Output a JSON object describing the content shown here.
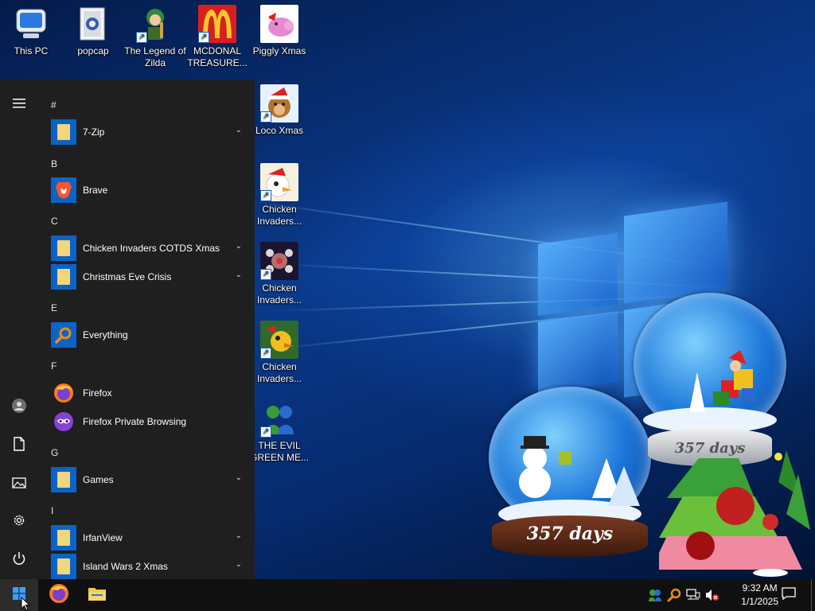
{
  "desktop": {
    "icons": [
      {
        "label": "This PC",
        "icon": "computer-icon"
      },
      {
        "label": "popcap",
        "icon": "folder-icon"
      },
      {
        "label": "The Legend of Zilda",
        "icon": "game-icon"
      },
      {
        "label": "MCDONAL TREASURE...",
        "icon": "game-icon"
      },
      {
        "label": "Piggly Xmas",
        "icon": "game-icon"
      },
      {
        "label": "Loco Xmas",
        "icon": "game-icon"
      },
      {
        "label": "Chicken Invaders...",
        "icon": "game-icon"
      },
      {
        "label": "Chicken Invaders...",
        "icon": "game-icon"
      },
      {
        "label": "Chicken Invaders...",
        "icon": "game-icon"
      },
      {
        "label": "THE EVIL GREEN ME...",
        "icon": "game-icon"
      }
    ],
    "widgets": {
      "globe_left_text": "357 days",
      "globe_right_text": "357 days"
    }
  },
  "start_menu": {
    "rail": [
      {
        "name": "expand-menu",
        "icon": "hamburger-icon"
      },
      {
        "name": "account",
        "icon": "user-icon"
      },
      {
        "name": "documents",
        "icon": "document-icon"
      },
      {
        "name": "pictures",
        "icon": "picture-icon"
      },
      {
        "name": "settings",
        "icon": "gear-icon"
      },
      {
        "name": "power",
        "icon": "power-icon"
      }
    ],
    "sections": [
      {
        "letter": "#",
        "apps": [
          {
            "label": "7-Zip",
            "type": "folder",
            "expandable": true
          }
        ]
      },
      {
        "letter": "B",
        "apps": [
          {
            "label": "Brave",
            "type": "brave",
            "expandable": false
          }
        ]
      },
      {
        "letter": "C",
        "apps": [
          {
            "label": "Chicken Invaders COTDS Xmas",
            "type": "folder",
            "expandable": true
          },
          {
            "label": "Christmas Eve Crisis",
            "type": "folder",
            "expandable": true
          }
        ]
      },
      {
        "letter": "E",
        "apps": [
          {
            "label": "Everything",
            "type": "search",
            "expandable": false
          }
        ]
      },
      {
        "letter": "F",
        "apps": [
          {
            "label": "Firefox",
            "type": "firefox",
            "expandable": false
          },
          {
            "label": "Firefox Private Browsing",
            "type": "firefox-private",
            "expandable": false
          }
        ]
      },
      {
        "letter": "G",
        "apps": [
          {
            "label": "Games",
            "type": "folder",
            "expandable": true
          }
        ]
      },
      {
        "letter": "I",
        "apps": [
          {
            "label": "IrfanView",
            "type": "folder",
            "expandable": true
          },
          {
            "label": "Island Wars 2 Xmas",
            "type": "folder",
            "expandable": true
          }
        ]
      }
    ]
  },
  "taskbar": {
    "pinned": [
      {
        "name": "start",
        "icon": "windows-logo-icon"
      },
      {
        "name": "firefox",
        "icon": "firefox-icon"
      },
      {
        "name": "file-explorer",
        "icon": "folder-icon"
      }
    ],
    "tray": [
      {
        "name": "app-tray",
        "icon": "tray-app-icon"
      },
      {
        "name": "everything",
        "icon": "search-icon"
      },
      {
        "name": "network",
        "icon": "network-icon"
      },
      {
        "name": "volume",
        "icon": "volume-muted-icon"
      }
    ],
    "time": "9:32 AM",
    "date": "1/1/2025",
    "notifications_icon": "notification-icon"
  },
  "colors": {
    "accent": "#0a64c8",
    "menu_bg": "#1f1f1f",
    "taskbar_bg": "#101010"
  }
}
